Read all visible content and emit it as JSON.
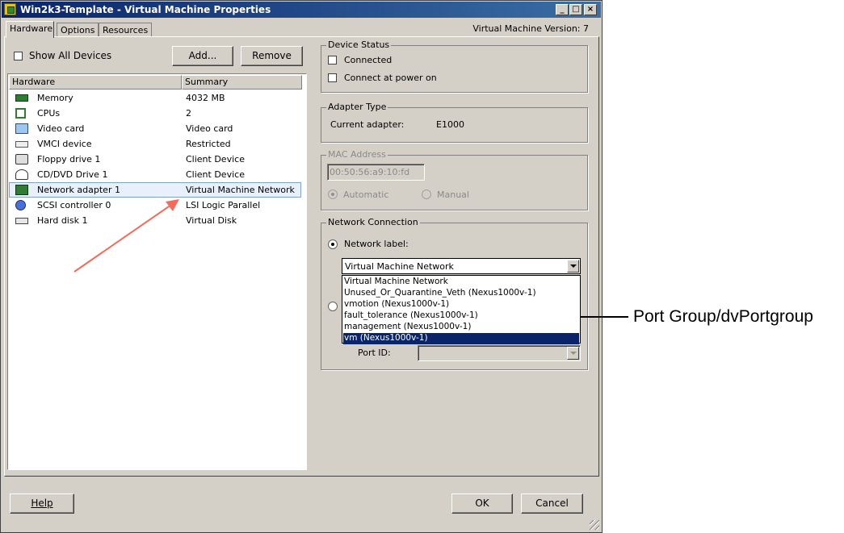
{
  "window": {
    "title": "Win2k3-Template - Virtual Machine Properties",
    "version_text": "Virtual Machine Version: 7",
    "tabs": [
      {
        "label": "Hardware",
        "active": true
      },
      {
        "label": "Options",
        "active": false
      },
      {
        "label": "Resources",
        "active": false
      }
    ]
  },
  "toolbar": {
    "show_all_devices_label": "Show All Devices",
    "show_all_devices_checked": false,
    "add_label": "Add...",
    "remove_label": "Remove"
  },
  "hardware_list": {
    "columns": [
      "Hardware",
      "Summary"
    ],
    "rows": [
      {
        "name": "Memory",
        "summary": "4032 MB",
        "icon": "memory-icon"
      },
      {
        "name": "CPUs",
        "summary": "2",
        "icon": "cpu-icon"
      },
      {
        "name": "Video card",
        "summary": "Video card",
        "icon": "monitor-icon"
      },
      {
        "name": "VMCI device",
        "summary": "Restricted",
        "icon": "vmci-icon"
      },
      {
        "name": "Floppy drive 1",
        "summary": "Client Device",
        "icon": "floppy-icon"
      },
      {
        "name": "CD/DVD Drive 1",
        "summary": "Client Device",
        "icon": "cdrom-icon"
      },
      {
        "name": "Network adapter 1",
        "summary": "Virtual Machine Network",
        "icon": "network-card-icon",
        "selected": true
      },
      {
        "name": "SCSI controller 0",
        "summary": "LSI Logic Parallel",
        "icon": "scsi-icon"
      },
      {
        "name": "Hard disk 1",
        "summary": "Virtual Disk",
        "icon": "disk-icon"
      }
    ]
  },
  "device_status": {
    "title": "Device Status",
    "connected_label": "Connected",
    "connected_checked": false,
    "connect_power_on_label": "Connect at power on",
    "connect_power_on_checked": false
  },
  "adapter_type": {
    "title": "Adapter Type",
    "current_adapter_label": "Current adapter:",
    "current_adapter_value": "E1000"
  },
  "mac_address": {
    "title": "MAC Address",
    "value": "00:50:56:a9:10:fd",
    "automatic_label": "Automatic",
    "manual_label": "Manual",
    "selected": "Automatic"
  },
  "network_connection": {
    "title": "Network Connection",
    "network_label_label": "Network label:",
    "selected_value": "Virtual Machine Network",
    "options": [
      "Virtual Machine Network",
      "Unused_Or_Quarantine_Veth (Nexus1000v-1)",
      "vmotion (Nexus1000v-1)",
      "fault_tolerance (Nexus1000v-1)",
      "management (Nexus1000v-1)",
      "vm (Nexus1000v-1)"
    ],
    "highlighted_option": "vm (Nexus1000v-1)",
    "port_id_label": "Port ID:"
  },
  "footer": {
    "help_label": "Help",
    "ok_label": "OK",
    "cancel_label": "Cancel"
  },
  "annotation": {
    "callout_text": "Port Group/dvPortgroup",
    "arrow_color": "#f26b5b"
  }
}
